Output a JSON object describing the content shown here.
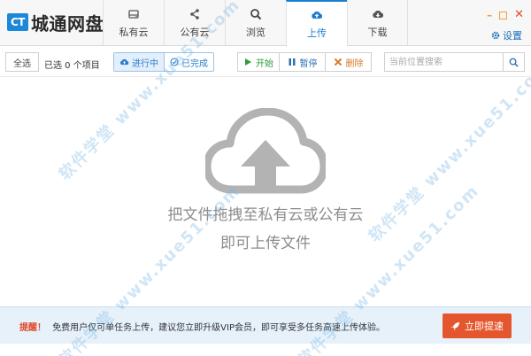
{
  "app": {
    "logo_badge": "CT",
    "logo_text": "城通网盘"
  },
  "tabs": [
    {
      "label": "私有云",
      "icon": "drive-icon"
    },
    {
      "label": "公有云",
      "icon": "share-icon"
    },
    {
      "label": "浏览",
      "icon": "search-icon"
    },
    {
      "label": "上传",
      "icon": "cloud-upload-icon",
      "active": true
    },
    {
      "label": "下载",
      "icon": "cloud-download-icon"
    }
  ],
  "window": {
    "minimize": "–",
    "close": "✕",
    "settings_label": "设置"
  },
  "toolbar": {
    "select_all": "全选",
    "selected_count": "已选 0 个项目",
    "in_progress": "进行中",
    "completed": "已完成",
    "start": "开始",
    "pause": "暂停",
    "delete": "删除",
    "search_placeholder": "当前位置搜索"
  },
  "main": {
    "hint_line1": "把文件拖拽至私有云或公有云",
    "hint_line2": "即可上传文件"
  },
  "notice": {
    "title": "提醒！",
    "text": "免费用户仅可单任务上传，建议您立即升级VIP会员，即可享受多任务高速上传体验。",
    "upgrade_button": "立即提速"
  },
  "watermark": "软件学堂 www.xue51.com",
  "colors": {
    "accent": "#1a7fd0",
    "upgrade": "#e4572e",
    "start": "#2e9a3b",
    "delete": "#d57a2e"
  }
}
